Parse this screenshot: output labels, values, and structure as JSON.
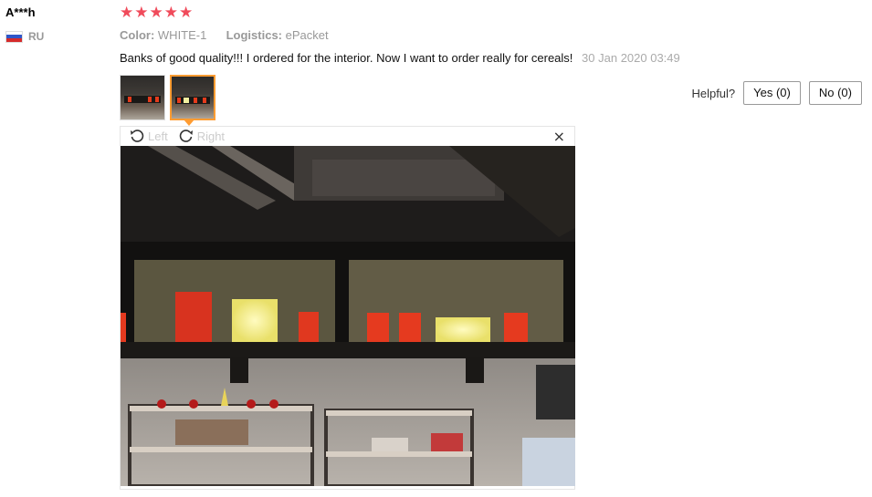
{
  "user": {
    "name": "A***h",
    "country": "RU"
  },
  "rating": {
    "stars": 5,
    "max": 5
  },
  "attributes": {
    "color_label": "Color:",
    "color_value": "WHITE-1",
    "logistics_label": "Logistics:",
    "logistics_value": "ePacket"
  },
  "review": {
    "text": "Banks of good quality!!! I ordered for the interior. Now I want to order really for cereals!",
    "date": "30 Jan 2020 03:49"
  },
  "helpful": {
    "label": "Helpful?",
    "yes": "Yes (0)",
    "no": "No (0)"
  },
  "viewer": {
    "rotate_left": "Left",
    "rotate_right": "Right",
    "close_glyph": "×",
    "icons": [
      "rotate-left-icon",
      "rotate-right-icon",
      "close-icon"
    ]
  },
  "colors": {
    "star": "#f04b5b",
    "active_thumb": "#ff9c32"
  }
}
